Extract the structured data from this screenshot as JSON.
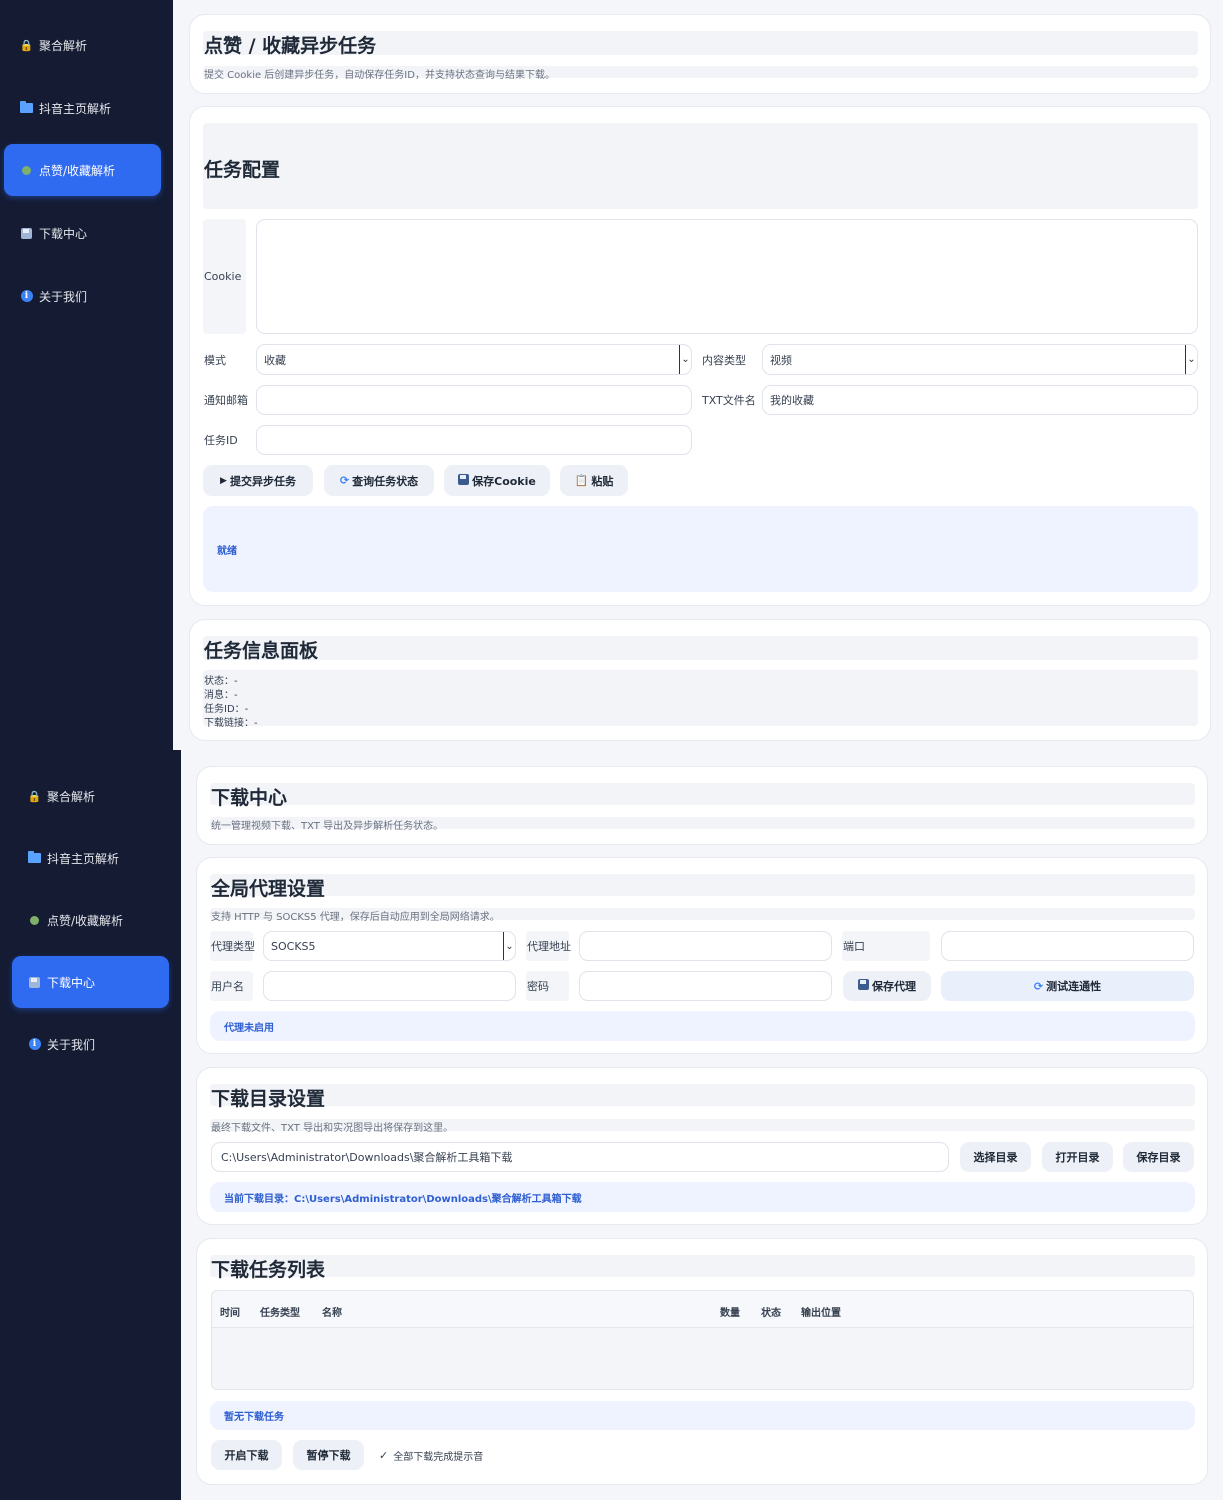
{
  "sidebar": {
    "items": [
      {
        "icon": "lock-icon",
        "label": "聚合解析"
      },
      {
        "icon": "folder-icon",
        "label": "抖音主页解析"
      },
      {
        "icon": "dot-icon",
        "label": "点赞/收藏解析"
      },
      {
        "icon": "save-icon",
        "label": "下载中心"
      },
      {
        "icon": "info-icon",
        "label": "关于我们"
      }
    ],
    "active_top": "点赞/收藏解析",
    "active_bottom": "下载中心"
  },
  "like_page": {
    "title": "点赞 / 收藏异步任务",
    "subtitle": "提交 Cookie 后创建异步任务，自动保存任务ID，并支持状态查询与结果下载。",
    "config": {
      "title": "任务配置",
      "cookie_label": "Cookie",
      "cookie_value": "",
      "mode_label": "模式",
      "mode_value": "收藏",
      "content_type_label": "内容类型",
      "content_type_value": "视频",
      "email_label": "通知邮箱",
      "email_value": "",
      "txt_label": "TXT文件名",
      "txt_value": "我的收藏",
      "task_id_label": "任务ID",
      "task_id_value": "",
      "buttons": {
        "submit": "提交异步任务",
        "query": "查询任务状态",
        "save_cookie": "保存Cookie",
        "paste": "粘贴"
      },
      "status": "就绪"
    },
    "info_panel": {
      "title": "任务信息面板",
      "lines": [
        "状态：-",
        "消息：-",
        "任务ID：-",
        "下载链接：-"
      ]
    }
  },
  "download_page": {
    "title": "下载中心",
    "subtitle": "统一管理视频下载、TXT 导出及异步解析任务状态。",
    "proxy": {
      "title": "全局代理设置",
      "subtitle": "支持 HTTP 与 SOCKS5 代理，保存后自动应用到全局网络请求。",
      "type_label": "代理类型",
      "type_value": "SOCKS5",
      "address_label": "代理地址",
      "address_value": "",
      "port_label": "端口",
      "port_value": "",
      "username_label": "用户名",
      "username_value": "",
      "password_label": "密码",
      "password_value": "",
      "save_button": "保存代理",
      "test_button": "测试连通性",
      "status": "代理未启用"
    },
    "directory": {
      "title": "下载目录设置",
      "subtitle": "最终下载文件、TXT 导出和实况图导出将保存到这里。",
      "path_value": "C:\\Users\\Administrator\\Downloads\\聚合解析工具箱下载",
      "choose_button": "选择目录",
      "open_button": "打开目录",
      "save_button": "保存目录",
      "current": "当前下载目录：C:\\Users\\Administrator\\Downloads\\聚合解析工具箱下载"
    },
    "tasks": {
      "title": "下载任务列表",
      "columns": [
        "时间",
        "任务类型",
        "名称",
        "数量",
        "状态",
        "输出位置"
      ],
      "rows": [],
      "empty": "暂无下载任务",
      "start_button": "开启下载",
      "pause_button": "暂停下载",
      "notify_label": "全部下载完成提示音",
      "notify_checked": true
    }
  }
}
